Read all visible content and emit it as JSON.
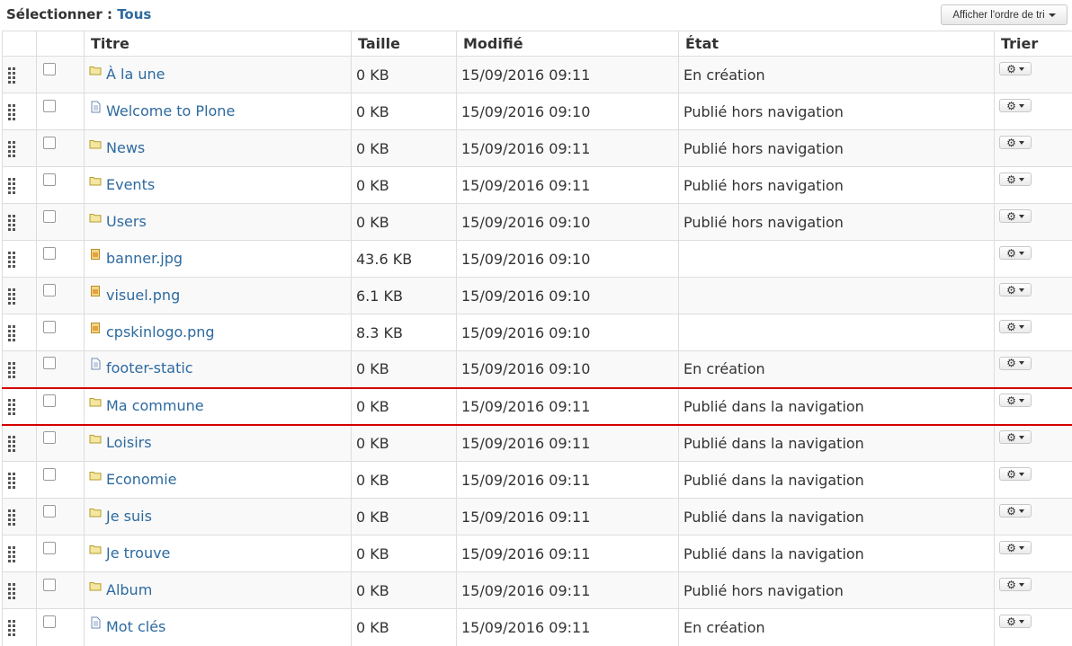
{
  "toolbar": {
    "select_prefix": "Sélectionner :",
    "select_all_link": "Tous",
    "sort_order_button": "Afficher l'ordre de tri"
  },
  "columns": {
    "title": "Titre",
    "size": "Taille",
    "modified": "Modifié",
    "state": "État",
    "sort": "Trier"
  },
  "rows": [
    {
      "icon": "folder-icon",
      "title": "À la une",
      "size": "0 KB",
      "modified": "15/09/2016 09:11",
      "state": "En création"
    },
    {
      "icon": "document-icon",
      "title": "Welcome to Plone",
      "size": "0 KB",
      "modified": "15/09/2016 09:10",
      "state": "Publié hors navigation"
    },
    {
      "icon": "folder-icon",
      "title": "News",
      "size": "0 KB",
      "modified": "15/09/2016 09:11",
      "state": "Publié hors navigation"
    },
    {
      "icon": "folder-icon",
      "title": "Events",
      "size": "0 KB",
      "modified": "15/09/2016 09:11",
      "state": "Publié hors navigation"
    },
    {
      "icon": "folder-icon",
      "title": "Users",
      "size": "0 KB",
      "modified": "15/09/2016 09:10",
      "state": "Publié hors navigation"
    },
    {
      "icon": "image-icon",
      "title": "banner.jpg",
      "size": "43.6 KB",
      "modified": "15/09/2016 09:10",
      "state": ""
    },
    {
      "icon": "image-icon",
      "title": "visuel.png",
      "size": "6.1 KB",
      "modified": "15/09/2016 09:10",
      "state": ""
    },
    {
      "icon": "image-icon",
      "title": "cpskinlogo.png",
      "size": "8.3 KB",
      "modified": "15/09/2016 09:10",
      "state": ""
    },
    {
      "icon": "document-icon",
      "title": "footer-static",
      "size": "0 KB",
      "modified": "15/09/2016 09:10",
      "state": "En création"
    },
    {
      "icon": "folder-icon",
      "title": "Ma commune",
      "size": "0 KB",
      "modified": "15/09/2016 09:11",
      "state": "Publié dans la navigation",
      "highlighted": true
    },
    {
      "icon": "folder-icon",
      "title": "Loisirs",
      "size": "0 KB",
      "modified": "15/09/2016 09:11",
      "state": "Publié dans la navigation"
    },
    {
      "icon": "folder-icon",
      "title": "Economie",
      "size": "0 KB",
      "modified": "15/09/2016 09:11",
      "state": "Publié dans la navigation"
    },
    {
      "icon": "folder-icon",
      "title": "Je suis",
      "size": "0 KB",
      "modified": "15/09/2016 09:11",
      "state": "Publié dans la navigation"
    },
    {
      "icon": "folder-icon",
      "title": "Je trouve",
      "size": "0 KB",
      "modified": "15/09/2016 09:11",
      "state": "Publié dans la navigation"
    },
    {
      "icon": "folder-icon",
      "title": "Album",
      "size": "0 KB",
      "modified": "15/09/2016 09:11",
      "state": "Publié hors navigation"
    },
    {
      "icon": "document-icon",
      "title": "Mot clés",
      "size": "0 KB",
      "modified": "15/09/2016 09:11",
      "state": "En création"
    }
  ],
  "colors": {
    "link": "#2d6a9f",
    "highlight_border": "#d40000",
    "row_stripe": "#f9f9f9"
  }
}
